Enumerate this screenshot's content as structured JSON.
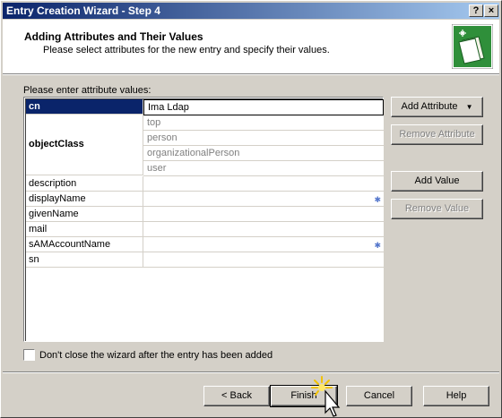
{
  "window": {
    "title": "Entry Creation Wizard - Step 4",
    "help_btn": "?",
    "close_btn": "×"
  },
  "header": {
    "title": "Adding Attributes and Their Values",
    "subtitle": "Please select attributes for the new entry and specify their values."
  },
  "grid": {
    "label": "Please enter attribute values:",
    "rows": [
      {
        "name": "cn",
        "value": "Ima Ldap"
      },
      {
        "name": "objectClass",
        "values": [
          "top",
          "person",
          "organizationalPerson",
          "user"
        ]
      },
      {
        "name": "description",
        "value": ""
      },
      {
        "name": "displayName",
        "value": ""
      },
      {
        "name": "givenName",
        "value": ""
      },
      {
        "name": "mail",
        "value": ""
      },
      {
        "name": "sAMAccountName",
        "value": ""
      },
      {
        "name": "sn",
        "value": ""
      }
    ]
  },
  "side_buttons": {
    "add_attribute": "Add Attribute",
    "remove_attribute": "Remove Attribute",
    "add_value": "Add Value",
    "remove_value": "Remove Value"
  },
  "checkbox": {
    "label": "Don't close the wizard after the entry has been added",
    "checked": false
  },
  "footer": {
    "back": "< Back",
    "finish": "Finish",
    "cancel": "Cancel",
    "help": "Help"
  },
  "colors": {
    "titlebar_start": "#0a246a",
    "titlebar_end": "#a6caf0",
    "selection": "#0a246a",
    "window_bg": "#d4d0c8"
  }
}
